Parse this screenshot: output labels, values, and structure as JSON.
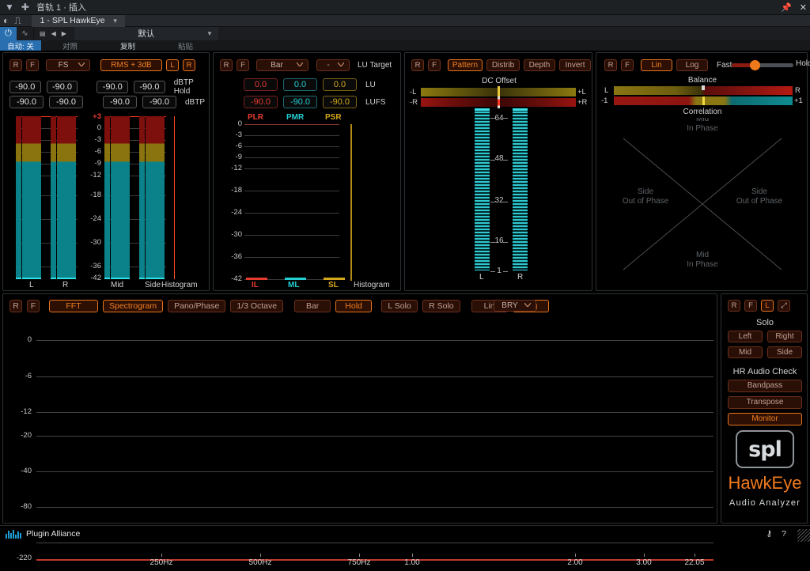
{
  "host": {
    "title": "音轨 1 · 插入",
    "plugin_name": "1 - SPL HawkEye",
    "preset": "默认",
    "auto_label": "自动: 关",
    "compare_label": "对照",
    "copy_label": "复制",
    "paste_label": "粘贴",
    "win_pin": "📌",
    "win_close": "✕",
    "icons": {
      "menu": "▼",
      "plus": "✚",
      "bypass": "◐",
      "routing": "⎍",
      "power": "⏻",
      "curve": "∿",
      "list": "▤",
      "prev": "◀",
      "next": "▶",
      "gear": "⚙",
      "caret": "▼"
    }
  },
  "level_panel": {
    "buttons": {
      "r": "R",
      "f": "F",
      "l": "L",
      "rr": "R"
    },
    "scale_select": "FS",
    "mode_button": "RMS + 3dB",
    "values": {
      "hold_l": "-90.0",
      "hold_r": "-90.0",
      "hold_mid": "-90.0",
      "hold_side": "-90.0",
      "cur_l": "-90.0",
      "cur_r": "-90.0",
      "cur_mid": "-90.0",
      "cur_side": "-90.0"
    },
    "row_labels": {
      "hold": "dBTP Hold",
      "cur": "dBTP"
    },
    "scale_ticks": [
      "+3",
      "0",
      "-3",
      "-6",
      "-9",
      "-12",
      "-18",
      "-24",
      "-30",
      "-36",
      "-42"
    ],
    "channel_labels": [
      "L",
      "R",
      "Mid",
      "Side"
    ],
    "histogram_label": "Histogram"
  },
  "loudness_panel": {
    "buttons": {
      "r": "R",
      "f": "F"
    },
    "display_select": "Bar",
    "target_select": "-",
    "target_label": "LU Target",
    "values": {
      "plr_lu": "0.0",
      "pmr_lu": "0.0",
      "psr_lu": "0.0",
      "plr_lufs": "-90.0",
      "pmr_lufs": "-90.0",
      "psr_lufs": "-90.0"
    },
    "unit_labels": {
      "lu": "LU",
      "lufs": "LUFS"
    },
    "top_labels": [
      "PLR",
      "PMR",
      "PSR"
    ],
    "bottom_labels": [
      "IL",
      "ML",
      "SL"
    ],
    "scale_ticks": [
      "0",
      "-3",
      "-6",
      "-9",
      "-12",
      "-18",
      "-24",
      "-30",
      "-36",
      "-42"
    ],
    "histogram_label": "Histogram"
  },
  "bit_panel": {
    "buttons": {
      "r": "R",
      "f": "F",
      "pattern": "Pattern",
      "distrib": "Distrib",
      "depth": "Depth",
      "invert": "Invert"
    },
    "dc_offset_label": "DC Offset",
    "dc_left_min": "-L",
    "dc_left_max": "+L",
    "dc_right_min": "-R",
    "dc_right_max": "+R",
    "scale_ticks": [
      "64",
      "48",
      "32",
      "16",
      "1"
    ],
    "channel_labels": {
      "l": "L",
      "r": "R"
    }
  },
  "phase_panel": {
    "buttons": {
      "r": "R",
      "f": "F",
      "lin": "Lin",
      "log": "Log"
    },
    "slider": {
      "left_label": "Fast",
      "right_label": "Hold",
      "value_pct": 36
    },
    "balance_label": "Balance",
    "balance_min": "L",
    "balance_max": "R",
    "correlation_label": "Correlation",
    "correlation_min": "-1",
    "correlation_max": "+1",
    "quadrants": {
      "top": [
        "Mid",
        "In Phase"
      ],
      "left": [
        "Side",
        "Out of Phase"
      ],
      "right": [
        "Side",
        "Out of Phase"
      ],
      "bottom": [
        "Mid",
        "In Phase"
      ]
    }
  },
  "spectrum": {
    "toolbar": [
      {
        "name": "r",
        "label": "R",
        "active": false,
        "shape": "sq"
      },
      {
        "name": "f",
        "label": "F",
        "active": false,
        "shape": "sq"
      },
      {
        "name": "fft",
        "label": "FFT",
        "active": true,
        "shape": "wide"
      },
      {
        "name": "spectrogram",
        "label": "Spectrogram",
        "active": true,
        "shape": "norm"
      },
      {
        "name": "pano-phase",
        "label": "Pano/Phase",
        "active": false,
        "shape": "norm"
      },
      {
        "name": "third-octave",
        "label": "1/3 Octave",
        "active": false,
        "shape": "norm"
      },
      {
        "name": "bar",
        "label": "Bar",
        "active": false,
        "shape": "norm"
      },
      {
        "name": "hold",
        "label": "Hold",
        "active": true,
        "shape": "norm"
      },
      {
        "name": "l-solo",
        "label": "L Solo",
        "active": false,
        "shape": "norm"
      },
      {
        "name": "r-solo",
        "label": "R Solo",
        "active": false,
        "shape": "norm"
      },
      {
        "name": "lin",
        "label": "Lin",
        "active": false,
        "shape": "norm"
      },
      {
        "name": "log",
        "label": "Log",
        "active": true,
        "shape": "norm"
      }
    ],
    "color_select": "BRY",
    "y_ticks": [
      "0",
      "-6",
      "-12",
      "-20",
      "-40",
      "-80",
      "-220"
    ],
    "x_ticks": [
      "250Hz",
      "500Hz",
      "750Hz",
      "1.00",
      "2.00",
      "3.00",
      "22.05"
    ]
  },
  "sidebar": {
    "top_buttons": [
      {
        "name": "r",
        "label": "R",
        "active": false
      },
      {
        "name": "f",
        "label": "F",
        "active": false
      },
      {
        "name": "l",
        "label": "L",
        "active": true
      },
      {
        "name": "resize",
        "label": "⤢",
        "active": false
      }
    ],
    "solo_title": "Solo",
    "solo_buttons": [
      "Left",
      "Right",
      "Mid",
      "Side"
    ],
    "hr_title": "HR Audio Check",
    "hr_buttons": [
      {
        "label": "Bandpass",
        "active": false
      },
      {
        "label": "Transpose",
        "active": false
      },
      {
        "label": "Monitor",
        "active": true
      }
    ],
    "logo_text": "spl",
    "brand": "HawkEye",
    "brand_sub": "Audio Analyzer"
  },
  "statusbar": {
    "vendor": "Plugin Alliance",
    "key_icon": "⚷",
    "help_icon": "?"
  },
  "colors": {
    "accent": "#f07a1e",
    "red": "#e83b2e",
    "cyan": "#24cfd4",
    "gold": "#d5a81c",
    "teal_meter": "#0b8289",
    "host_blue": "#2a6fb0"
  }
}
